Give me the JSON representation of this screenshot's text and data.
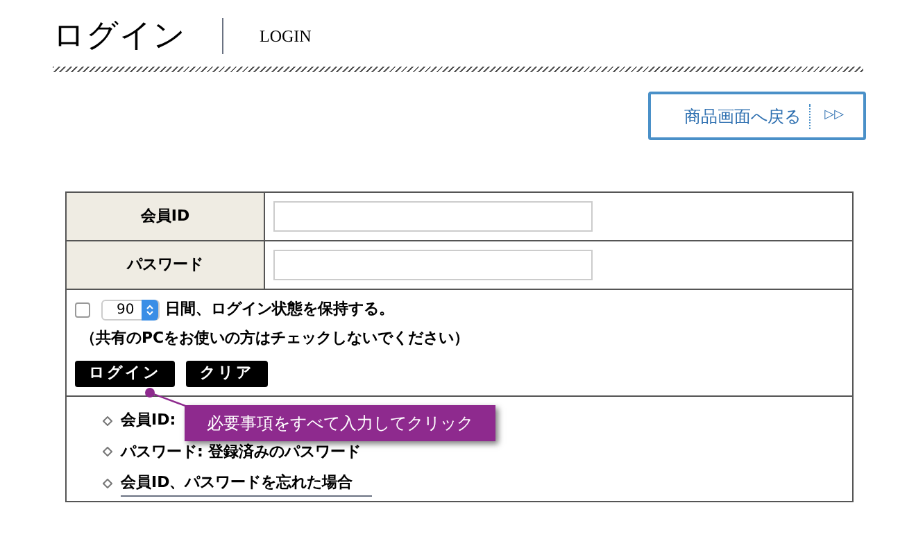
{
  "header": {
    "title": "ログイン",
    "subtitle": "LOGIN"
  },
  "back_button": {
    "label": "商品画面へ戻る",
    "arrow": "▷▷"
  },
  "form": {
    "fields": [
      {
        "label": "会員ID"
      },
      {
        "label": "パスワード"
      }
    ],
    "remember": {
      "checked": false,
      "days": "90",
      "text": "日間、ログイン状態を保持する。",
      "note": "（共有のPCをお使いの方はチェックしないでください）"
    },
    "buttons": [
      "ログイン",
      "クリア"
    ],
    "notes": [
      {
        "text": "会員ID:",
        "kind": "text"
      },
      {
        "text": "パスワード: 登録済みのパスワード",
        "kind": "text"
      },
      {
        "text": "会員ID、パスワードを忘れた場合",
        "kind": "link"
      }
    ]
  },
  "callout": {
    "text": "必要事項をすべて入力してクリック"
  }
}
